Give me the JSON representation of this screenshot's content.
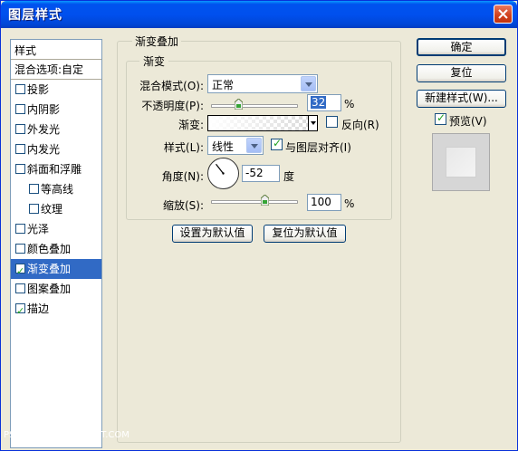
{
  "window": {
    "title": "图层样式",
    "close_label": "×"
  },
  "style_list": {
    "header": "样式",
    "blend_options": "混合选项:自定",
    "items": [
      {
        "label": "投影",
        "checked": false,
        "sub": false,
        "selected": false
      },
      {
        "label": "内阴影",
        "checked": false,
        "sub": false,
        "selected": false
      },
      {
        "label": "外发光",
        "checked": false,
        "sub": false,
        "selected": false
      },
      {
        "label": "内发光",
        "checked": false,
        "sub": false,
        "selected": false
      },
      {
        "label": "斜面和浮雕",
        "checked": false,
        "sub": false,
        "selected": false
      },
      {
        "label": "等高线",
        "checked": false,
        "sub": true,
        "selected": false
      },
      {
        "label": "纹理",
        "checked": false,
        "sub": true,
        "selected": false
      },
      {
        "label": "光泽",
        "checked": false,
        "sub": false,
        "selected": false
      },
      {
        "label": "颜色叠加",
        "checked": false,
        "sub": false,
        "selected": false
      },
      {
        "label": "渐变叠加",
        "checked": true,
        "sub": false,
        "selected": true
      },
      {
        "label": "图案叠加",
        "checked": false,
        "sub": false,
        "selected": false
      },
      {
        "label": "描边",
        "checked": true,
        "sub": false,
        "selected": false
      }
    ]
  },
  "panel": {
    "outer_title": "渐变叠加",
    "inner_title": "渐变",
    "blend_mode_label": "混合模式(O):",
    "blend_mode_value": "正常",
    "opacity_label": "不透明度(P):",
    "opacity_value": "32",
    "opacity_level": 0.32,
    "percent": "%",
    "gradient_label": "渐变:",
    "reverse_label": "反向(R)",
    "reverse_checked": false,
    "style_label": "样式(L):",
    "style_value": "线性",
    "align_label": "与图层对齐(I)",
    "align_checked": true,
    "angle_label": "角度(N):",
    "angle_value": "-52",
    "angle_unit": "度",
    "scale_label": "缩放(S):",
    "scale_value": "100",
    "scale_level": 1.0,
    "set_default_label": "设置为默认值",
    "reset_default_label": "复位为默认值"
  },
  "buttons": {
    "ok": "确定",
    "reset": "复位",
    "new_style": "新建样式(W)...",
    "preview_label": "预览(V)",
    "preview_checked": true
  },
  "watermark": "PS学堂 — www.52PSXT.COM",
  "colors": {
    "title_bar": "#0053ee",
    "selected_row": "#316ac5",
    "dialog_bg": "#ece9d8",
    "check_color": "#21a121"
  }
}
